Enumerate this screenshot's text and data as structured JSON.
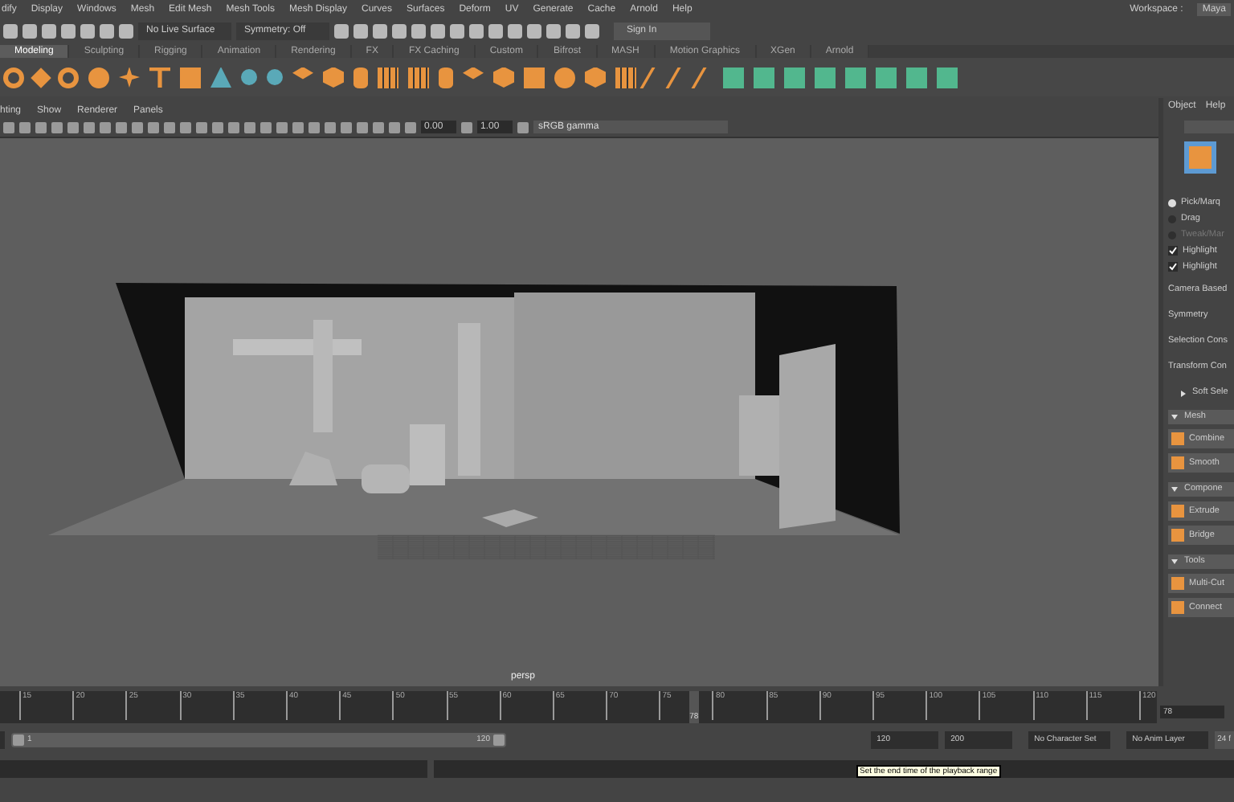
{
  "menu_bar": {
    "items": [
      "dify",
      "Display",
      "Windows",
      "Mesh",
      "Edit Mesh",
      "Mesh Tools",
      "Mesh Display",
      "Curves",
      "Surfaces",
      "Deform",
      "UV",
      "Generate",
      "Cache",
      "Arnold",
      "Help"
    ],
    "workspace_label": "Workspace :",
    "workspace_value": "Maya"
  },
  "status_line": {
    "live_surface": "No Live Surface",
    "symmetry": "Symmetry: Off",
    "sign_in": "Sign In"
  },
  "shelf_tabs": [
    {
      "label": "Modeling",
      "selected": true
    },
    {
      "label": "Sculpting",
      "selected": false
    },
    {
      "label": "Rigging",
      "selected": false
    },
    {
      "label": "Animation",
      "selected": false
    },
    {
      "label": "Rendering",
      "selected": false
    },
    {
      "label": "FX",
      "selected": false
    },
    {
      "label": "FX Caching",
      "selected": false
    },
    {
      "label": "Custom",
      "selected": false
    },
    {
      "label": "Bifrost",
      "selected": false
    },
    {
      "label": "MASH",
      "selected": false
    },
    {
      "label": "Motion Graphics",
      "selected": false
    },
    {
      "label": "XGen",
      "selected": false
    },
    {
      "label": "Arnold",
      "selected": false
    }
  ],
  "viewport": {
    "menu": [
      "hting",
      "Show",
      "Renderer",
      "Panels"
    ],
    "exposure": "0.00",
    "gamma": "1.00",
    "color_space": "sRGB gamma",
    "camera_label": "persp"
  },
  "tool_panel": {
    "menu": [
      "Object",
      "Help"
    ],
    "pick_modes": [
      {
        "label": "Pick/Marq",
        "selected": true,
        "disabled": false
      },
      {
        "label": "Drag",
        "selected": false,
        "disabled": false
      },
      {
        "label": "Tweak/Mar",
        "selected": false,
        "disabled": true
      }
    ],
    "highlights": [
      {
        "label": "Highlight",
        "checked": true
      },
      {
        "label": "Highlight",
        "checked": true
      }
    ],
    "camera_based": "Camera Based",
    "symmetry": "Symmetry",
    "selection_constraint": "Selection Cons",
    "transform_constraint": "Transform Con",
    "soft_select": {
      "label": "Soft Sele",
      "expanded": false
    },
    "sections": [
      {
        "title": "Mesh",
        "expanded": true,
        "tools": [
          "Combine",
          "Smooth"
        ]
      },
      {
        "title": "Compone",
        "expanded": true,
        "tools": [
          "Extrude",
          "Bridge"
        ]
      },
      {
        "title": "Tools",
        "expanded": true,
        "tools": [
          "Multi-Cut",
          "Connect"
        ]
      }
    ]
  },
  "timeline": {
    "labels": [
      "15",
      "20",
      "25",
      "30",
      "35",
      "40",
      "45",
      "50",
      "55",
      "60",
      "65",
      "70",
      "75",
      "80",
      "85",
      "90",
      "95",
      "100",
      "105",
      "110",
      "115",
      "120"
    ],
    "current_frame": "78",
    "level": 0.596,
    "current_field": "78"
  },
  "range": {
    "level": 1,
    "start": "1",
    "end": "120",
    "end_field": "120",
    "max_field": "200",
    "character_set": "No Character Set",
    "anim_layer": "No Anim Layer",
    "fps": "24 f"
  },
  "tooltip": "Set the end time of the playback range"
}
